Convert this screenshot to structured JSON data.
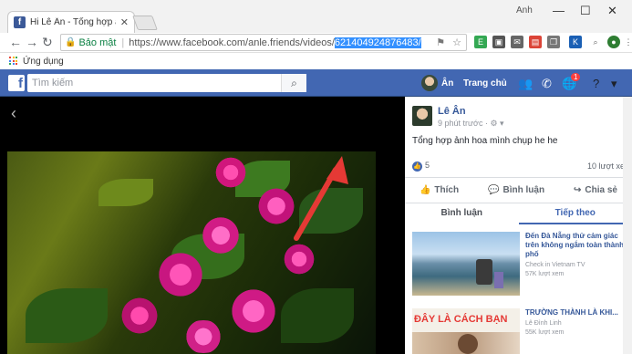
{
  "browser": {
    "tab_title": "Hi Lê Ân - Tổng hợp ảnh h...",
    "profile_name": "Anh",
    "omnibox": {
      "secure_label": "Bảo mật",
      "url_base": "https://www.facebook.com/anle.friends/videos/",
      "url_highlight": "621404924876483/"
    },
    "bookmark_label": "Ứng dụng"
  },
  "facebook": {
    "search_placeholder": "Tìm kiếm",
    "user_name": "Ân",
    "home_label": "Trang chủ",
    "notification_count": "1"
  },
  "post": {
    "author": "Lê Ân",
    "time": "9 phút trước · ⚙ ▾",
    "text": "Tổng hợp ảnh hoa mình chụp he he",
    "reaction_count": "5",
    "view_count": "10 lượt xe",
    "actions": {
      "like": "Thích",
      "comment": "Bình luận",
      "share": "Chia sẻ"
    },
    "tabs": {
      "comments": "Bình luận",
      "next": "Tiếp theo"
    }
  },
  "related_videos": [
    {
      "title": "Đến Đà Nẵng thử cảm giác trên không ngắm toàn thành phố",
      "source": "Check in Vietnam TV",
      "views": "57K lượt xem"
    },
    {
      "title": "TRƯỜNG THÀNH LÀ KHI...",
      "source": "Lê Đình Linh",
      "views": "55K lượt xem"
    }
  ],
  "thumb_caption": "ĐÂY LÀ CÁCH BẠN",
  "colors": {
    "fb_blue": "#4267b2",
    "link": "#365899",
    "arrow": "#e53935"
  }
}
